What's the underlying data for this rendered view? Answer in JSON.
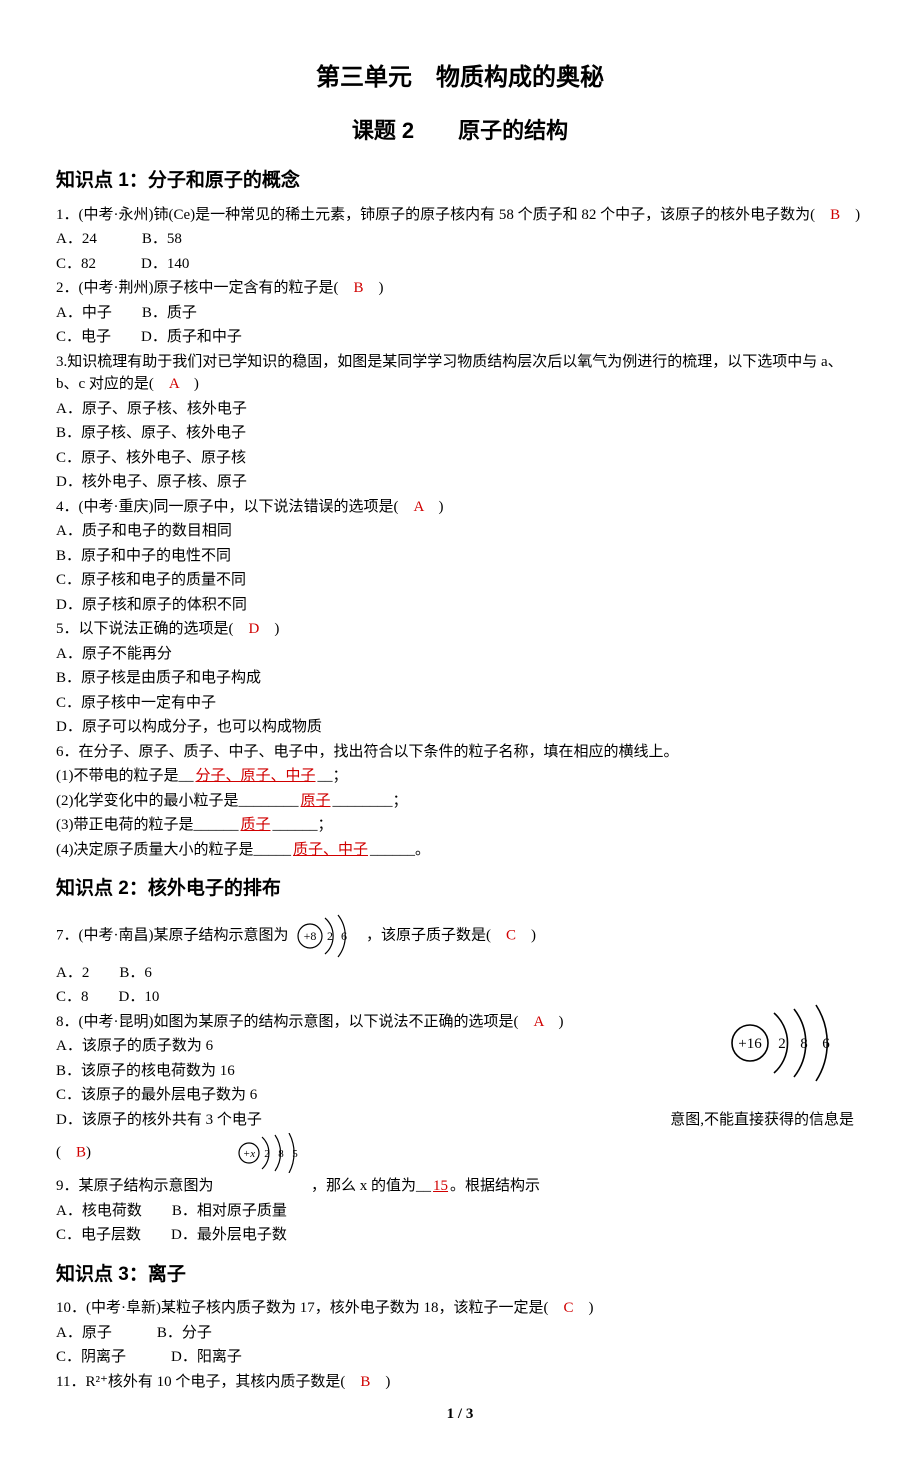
{
  "header": {
    "unit_title": "第三单元　物质构成的奥秘",
    "lesson_title": "课题 2　　原子的结构"
  },
  "section1": {
    "heading": "知识点 1：分子和原子的概念",
    "q1": {
      "text_a": "1．(中考·永州)铈(Ce)是一种常见的稀土元素，铈原子的原子核内有 58 个质子和 82 个中子，该原子的核外电子数为(　",
      "ans": "B",
      "text_b": "　)",
      "optA": "A．24　　　B．58",
      "optC": "C．82　　　D．140"
    },
    "q2": {
      "text_a": "2．(中考·荆州)原子核中一定含有的粒子是(　",
      "ans": "B",
      "text_b": "　)",
      "optA": "A．中子　　B．质子",
      "optC": "C．电子　　D．质子和中子"
    },
    "q3": {
      "intro": "3.知识梳理有助于我们对已学知识的稳固，如图是某同学学习物质结构层次后以氧气为例进行的梳理，以下选项中与 a、b、c 对应的是(　",
      "ans": "A",
      "intro_b": "　)",
      "optA": "A．原子、原子核、核外电子",
      "optB": "B．原子核、原子、核外电子",
      "optC": "C．原子、核外电子、原子核",
      "optD": "D．核外电子、原子核、原子"
    },
    "q4": {
      "text_a": "4．(中考·重庆)同一原子中，以下说法错误的选项是(　",
      "ans": "A",
      "text_b": "　)",
      "optA": "A．质子和电子的数目相同",
      "optB": "B．原子和中子的电性不同",
      "optC": "C．原子核和电子的质量不同",
      "optD": "D．原子核和原子的体积不同"
    },
    "q5": {
      "text_a": "5．以下说法正确的选项是(　",
      "ans": "D",
      "text_b": "　)",
      "optA": "A．原子不能再分",
      "optB": "B．原子核是由质子和电子构成",
      "optC": "C．原子核中一定有中子",
      "optD": "D．原子可以构成分子，也可以构成物质"
    },
    "q6": {
      "intro": "6．在分子、原子、质子、中子、电子中，找出符合以下条件的粒子名称，填在相应的横线上。",
      "p1a": "(1)不带电的粒子是__",
      "p1ans": "分子、原子、中子",
      "p1b": "__；",
      "p2a": "(2)化学变化中的最小粒子是________",
      "p2ans": "原子",
      "p2b": "________；",
      "p3a": "(3)带正电荷的粒子是______",
      "p3ans": "质子",
      "p3b": "______；",
      "p4a": "(4)决定原子质量大小的粒子是_____",
      "p4ans": "质子、中子",
      "p4b": "______。"
    }
  },
  "section2": {
    "heading": "知识点 2：核外电子的排布",
    "q7": {
      "text_a": "7．(中考·南昌)某原子结构示意图为",
      "text_b": "，该原子质子数是(　",
      "ans": "C",
      "text_c": "　)",
      "optA": "A．2　　B．6",
      "optC": "C．8　　D．10",
      "diagram": {
        "center": "+8",
        "shells": [
          "2",
          "6"
        ]
      }
    },
    "q8": {
      "text_a": "8．(中考·昆明)如图为某原子的结构示意图，以下说法不正确的选项是(　",
      "ans": "A",
      "text_b": "　)",
      "optA": "A．该原子的质子数为 6",
      "optB": "B．该原子的核电荷数为 16",
      "optC": "C．该原子的最外层电子数为 6",
      "optD": "D．该原子的核外共有 3 个电子",
      "diagram": {
        "center": "+16",
        "shells": [
          "2",
          "8",
          "6"
        ]
      },
      "tail": "意图,不能直接获得的信息是"
    },
    "q9": {
      "row1_a": "(　",
      "row1_ans": "B",
      "row1_b": ")",
      "row2_a": "9．某原子结构示意图为",
      "row2_b": "，那么 x 的值为__",
      "row2_ans": "15",
      "row2_c": "。根据结构示",
      "row3a": "A．核电荷数　　B．相对原子质量",
      "row3c": "C．电子层数　　D．最外层电子数",
      "diagram": {
        "center": "+x",
        "shells": [
          "2",
          "8",
          "5"
        ]
      }
    }
  },
  "section3": {
    "heading": "知识点 3：离子",
    "q10": {
      "text_a": "10．(中考·阜新)某粒子核内质子数为 17，核外电子数为 18，该粒子一定是(　",
      "ans": "C",
      "text_b": "　)",
      "optA": "A．原子　　　B．分子",
      "optC": "C．阴离子　　　D．阳离子"
    },
    "q11": {
      "text_a": "11．R²⁺核外有 10 个电子，其核内质子数是(　",
      "ans": "B",
      "text_b": "　)"
    }
  },
  "page": "1 / 3"
}
